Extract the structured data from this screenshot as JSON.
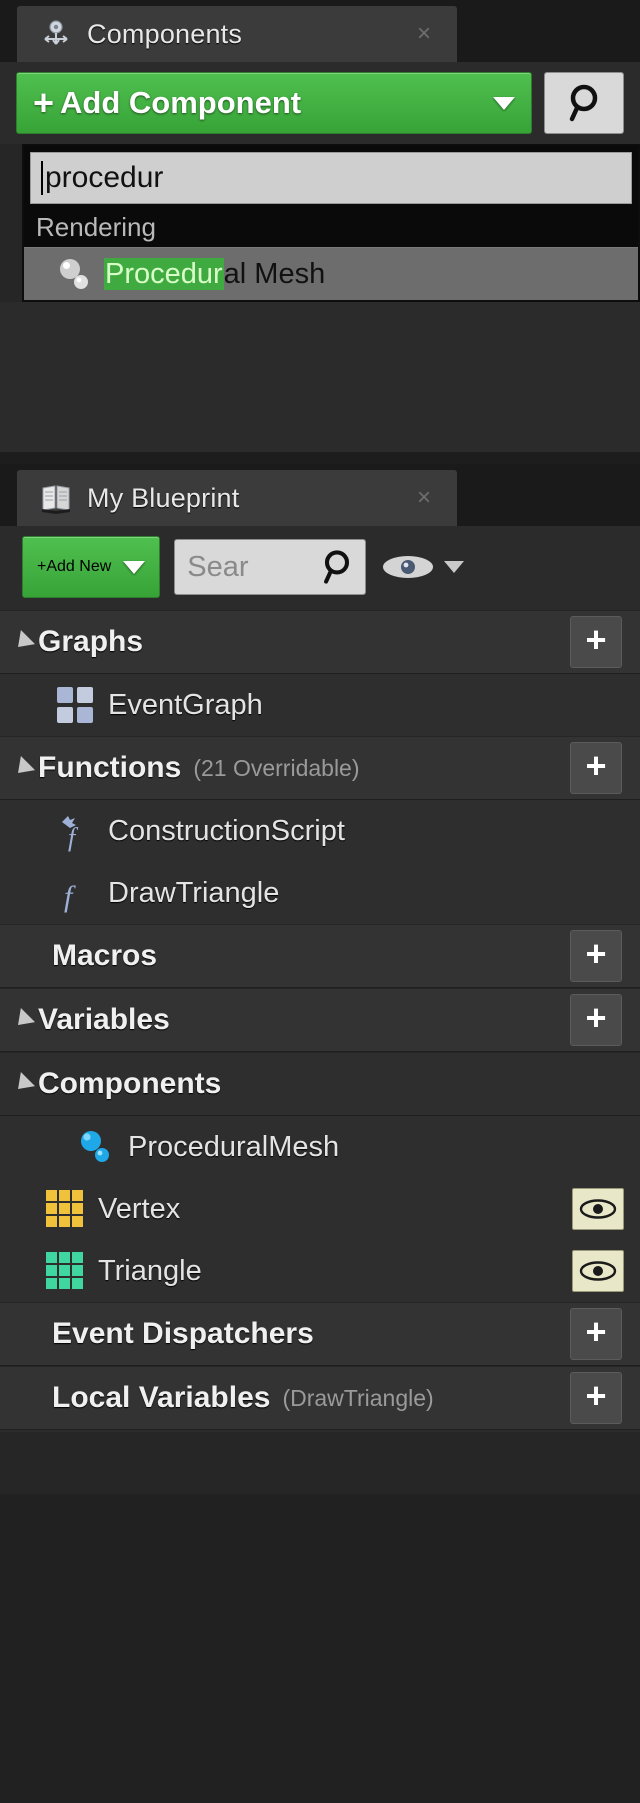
{
  "components_panel": {
    "tab_title": "Components",
    "tab_icon": "components-cube-icon",
    "close_label": "×",
    "add_component_button": {
      "plus": "+",
      "label": "Add Component",
      "caret": "chevron-down-icon"
    },
    "search_button_icon": "magnifier-icon",
    "dropdown": {
      "search_value": "procedur",
      "group_label": "Rendering",
      "result": {
        "icon": "procedural-mesh-icon",
        "match": "Procedur",
        "rest": "al Mesh"
      }
    }
  },
  "my_blueprint_panel": {
    "tab_title": "My Blueprint",
    "tab_icon": "blueprint-book-icon",
    "close_label": "×",
    "add_new_button": {
      "plus": "+",
      "label": "Add New",
      "caret": "chevron-down-icon"
    },
    "search": {
      "placeholder": "Sear",
      "icon": "magnifier-icon"
    },
    "visibility": {
      "icon": "eye-icon",
      "caret": "chevron-down-icon"
    },
    "tree": [
      {
        "type": "category",
        "label": "Graphs",
        "sub": "",
        "expanded": true,
        "has_add": true,
        "children": [
          {
            "label": "EventGraph",
            "icon": "event-graph-icon"
          }
        ]
      },
      {
        "type": "category",
        "label": "Functions",
        "sub": "(21 Overridable)",
        "expanded": true,
        "has_add": true,
        "children": [
          {
            "label": "ConstructionScript",
            "icon": "construction-script-icon"
          },
          {
            "label": "DrawTriangle",
            "icon": "function-icon"
          }
        ]
      },
      {
        "type": "category",
        "label": "Macros",
        "sub": "",
        "expanded": false,
        "has_add": true,
        "children": []
      },
      {
        "type": "category",
        "label": "Variables",
        "sub": "",
        "expanded": true,
        "has_add": true,
        "children": []
      },
      {
        "type": "subcategory",
        "label": "Components",
        "sub": "",
        "expanded": true,
        "has_add": false,
        "children": [
          {
            "label": "ProceduralMesh",
            "icon": "procedural-mesh-icon",
            "eye": false
          },
          {
            "label": "Vertex",
            "icon": "array-grid-icon",
            "color": "#f0c13a",
            "eye": true
          },
          {
            "label": "Triangle",
            "icon": "array-grid-icon",
            "color": "#3fd6a0",
            "eye": true
          }
        ]
      },
      {
        "type": "category",
        "label": "Event Dispatchers",
        "sub": "",
        "expanded": false,
        "has_add": true,
        "children": []
      },
      {
        "type": "category",
        "label": "Local Variables",
        "sub": "(DrawTriangle)",
        "expanded": false,
        "has_add": true,
        "children": []
      }
    ]
  },
  "colors": {
    "accent_green": "#3faa3f",
    "vertex_array": "#f0c13a",
    "triangle_array": "#3fd6a0",
    "panel_bg": "#2b2b2b",
    "row_bg": "#2e2e2e",
    "category_bg": "#333333"
  }
}
